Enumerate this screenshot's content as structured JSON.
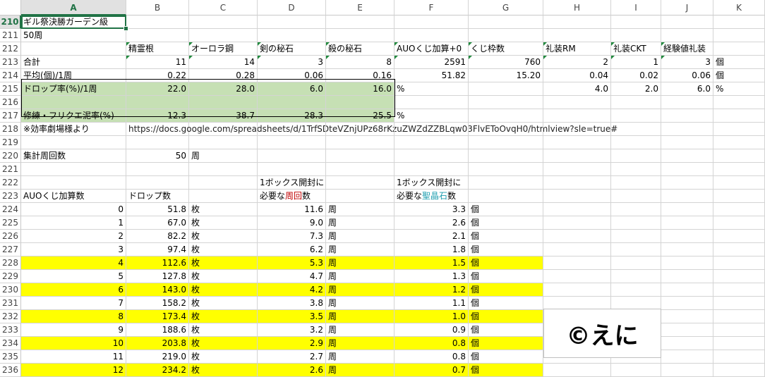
{
  "columns": [
    "A",
    "B",
    "C",
    "D",
    "E",
    "F",
    "G",
    "H",
    "I",
    "J",
    "K"
  ],
  "selected_column": "A",
  "selected_row": "210",
  "rows": {
    "r210": {
      "num": "210",
      "a": "ギル祭決勝ガーデン級"
    },
    "r211": {
      "num": "211",
      "a": "50周"
    },
    "r212": {
      "num": "212",
      "b": "精霊根",
      "c": "オーロラ鋼",
      "d": "剣の秘石",
      "e": "殺の秘石",
      "f": "AUOくじ加算+0",
      "g": "くじ枠数",
      "h": "礼装RM",
      "i": "礼装CKT",
      "j": "経験値礼装"
    },
    "r213": {
      "num": "213",
      "a": "合計",
      "b": "11",
      "c": "14",
      "d": "3",
      "e": "8",
      "f": "2591",
      "g": "760",
      "h": "2",
      "i": "1",
      "j": "3",
      "k": "個"
    },
    "r214": {
      "num": "214",
      "a": "平均(個)/1周",
      "b": "0.22",
      "c": "0.28",
      "d": "0.06",
      "e": "0.16",
      "f": "51.82",
      "g": "15.20",
      "h": "0.04",
      "i": "0.02",
      "j": "0.06",
      "k": "個"
    },
    "r215": {
      "num": "215",
      "a": "ドロップ率(%)/1周",
      "b": "22.0",
      "c": "28.0",
      "d": "6.0",
      "e": "16.0",
      "f": "%",
      "h": "4.0",
      "i": "2.0",
      "j": "6.0",
      "k": "%"
    },
    "r216": {
      "num": "216"
    },
    "r217": {
      "num": "217",
      "a": "修練・フリクエ泥率(%)",
      "b": "12.3",
      "c": "38.7",
      "d": "28.3",
      "e": "25.5",
      "f": "%"
    },
    "r218": {
      "num": "218",
      "a": "※効率劇場様より",
      "b": "https://docs.google.com/spreadsheets/d/1TrfSDteVZnjUPz68rKzuZWZdZZBLqw03FlvEToOvqH0/htmlview?sle=true#"
    },
    "r219": {
      "num": "219"
    },
    "r220": {
      "num": "220",
      "a": "集計周回数",
      "b": "50",
      "c": "周"
    },
    "r221": {
      "num": "221"
    },
    "r222": {
      "num": "222",
      "d": "1ボックス開封に",
      "f": "1ボックス開封に"
    },
    "r223": {
      "num": "223",
      "a": "AUOくじ加算数",
      "b": "ドロップ数",
      "d_pre": "必要な",
      "d_red": "周回",
      "d_post": "数",
      "f_pre": "必要な",
      "f_teal": "聖晶石",
      "f_post": "数"
    }
  },
  "table": {
    "unit_drop": "枚",
    "unit_runs": "周",
    "unit_sq": "個",
    "rows": [
      {
        "num": "224",
        "bonus": "0",
        "drop": "51.8",
        "runs": "11.6",
        "sq": "3.3",
        "highlight": false
      },
      {
        "num": "225",
        "bonus": "1",
        "drop": "67.0",
        "runs": "9.0",
        "sq": "2.6",
        "highlight": false
      },
      {
        "num": "226",
        "bonus": "2",
        "drop": "82.2",
        "runs": "7.3",
        "sq": "2.1",
        "highlight": false
      },
      {
        "num": "227",
        "bonus": "3",
        "drop": "97.4",
        "runs": "6.2",
        "sq": "1.8",
        "highlight": false
      },
      {
        "num": "228",
        "bonus": "4",
        "drop": "112.6",
        "runs": "5.3",
        "sq": "1.5",
        "highlight": true
      },
      {
        "num": "229",
        "bonus": "5",
        "drop": "127.8",
        "runs": "4.7",
        "sq": "1.3",
        "highlight": false
      },
      {
        "num": "230",
        "bonus": "6",
        "drop": "143.0",
        "runs": "4.2",
        "sq": "1.2",
        "highlight": true
      },
      {
        "num": "231",
        "bonus": "7",
        "drop": "158.2",
        "runs": "3.8",
        "sq": "1.1",
        "highlight": false
      },
      {
        "num": "232",
        "bonus": "8",
        "drop": "173.4",
        "runs": "3.5",
        "sq": "1.0",
        "highlight": true
      },
      {
        "num": "233",
        "bonus": "9",
        "drop": "188.6",
        "runs": "3.2",
        "sq": "0.9",
        "highlight": false
      },
      {
        "num": "234",
        "bonus": "10",
        "drop": "203.8",
        "runs": "2.9",
        "sq": "0.8",
        "highlight": true
      },
      {
        "num": "235",
        "bonus": "11",
        "drop": "219.0",
        "runs": "2.7",
        "sq": "0.8",
        "highlight": false
      },
      {
        "num": "236",
        "bonus": "12",
        "drop": "234.2",
        "runs": "2.6",
        "sq": "0.7",
        "highlight": true
      }
    ]
  },
  "watermark": "©えに",
  "colors": {
    "highlight": "#ffff00",
    "green_fill": "#c6e0b4",
    "accent": "#217346",
    "red_text": "#c00000",
    "teal_text": "#1f9fb0"
  }
}
